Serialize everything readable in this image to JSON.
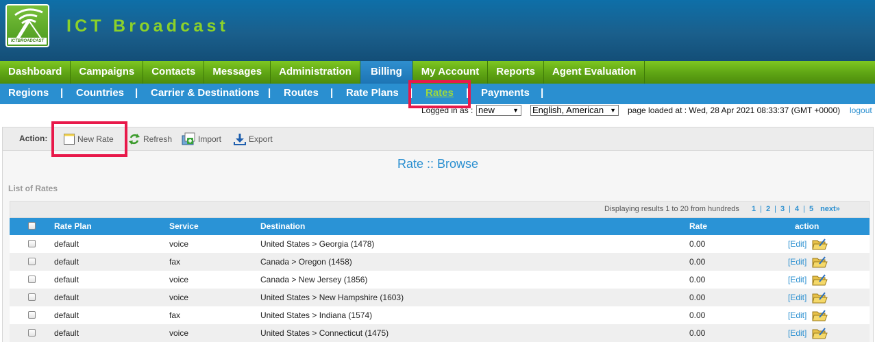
{
  "app": {
    "title": "ICT Broadcast",
    "logo_text": "ICTBROADCAST"
  },
  "main_nav": [
    {
      "label": "Dashboard",
      "active": false
    },
    {
      "label": "Campaigns",
      "active": false
    },
    {
      "label": "Contacts",
      "active": false
    },
    {
      "label": "Messages",
      "active": false
    },
    {
      "label": "Administration",
      "active": false
    },
    {
      "label": "Billing",
      "active": true
    },
    {
      "label": "My Account",
      "active": false
    },
    {
      "label": "Reports",
      "active": false
    },
    {
      "label": "Agent Evaluation",
      "active": false
    }
  ],
  "sub_nav": [
    {
      "label": "Regions"
    },
    {
      "label": "Countries"
    },
    {
      "label": "Carrier & Destinations"
    },
    {
      "label": "Routes"
    },
    {
      "label": "Rate Plans"
    },
    {
      "label": "Rates",
      "active": true
    },
    {
      "label": "Payments"
    }
  ],
  "sub_nav_separator": "|",
  "status": {
    "logged_in_label": "Logged in as :",
    "user_select": "new",
    "language_select": "English, American",
    "page_loaded": "page loaded at : Wed, 28 Apr 2021 08:33:37 (GMT +0000)",
    "logout": "logout"
  },
  "actions": {
    "label": "Action:",
    "new_rate": "New Rate",
    "refresh": "Refresh",
    "import": "Import",
    "export": "Export"
  },
  "page_heading": "Rate :: Browse",
  "list_title": "List of Rates",
  "pager": {
    "info": "Displaying results 1 to 20 from hundreds",
    "pages": [
      "1",
      "2",
      "3",
      "4",
      "5"
    ],
    "next": "next»"
  },
  "table": {
    "columns": [
      "Rate Plan",
      "Service",
      "Destination",
      "Rate",
      "action"
    ],
    "edit_label": "[Edit]",
    "rows": [
      {
        "rate_plan": "default",
        "service": "voice",
        "destination": "United States > Georgia (1478)",
        "rate": "0.00"
      },
      {
        "rate_plan": "default",
        "service": "fax",
        "destination": "Canada > Oregon (1458)",
        "rate": "0.00"
      },
      {
        "rate_plan": "default",
        "service": "voice",
        "destination": "Canada > New Jersey (1856)",
        "rate": "0.00"
      },
      {
        "rate_plan": "default",
        "service": "voice",
        "destination": "United States > New Hampshire (1603)",
        "rate": "0.00"
      },
      {
        "rate_plan": "default",
        "service": "fax",
        "destination": "United States > Indiana (1574)",
        "rate": "0.00"
      },
      {
        "rate_plan": "default",
        "service": "voice",
        "destination": "United States > Connecticut (1475)",
        "rate": "0.00"
      }
    ]
  },
  "colors": {
    "header_blue": "#1a5f8c",
    "nav_green": "#5ea414",
    "accent_blue": "#2a8fd0",
    "highlight_red": "#e8194a",
    "title_green": "#8bd12a"
  }
}
